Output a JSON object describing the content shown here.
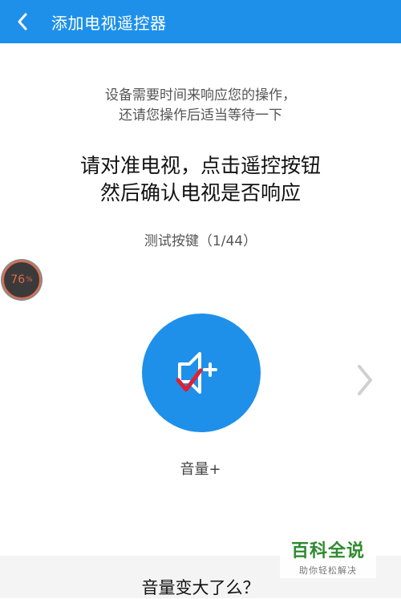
{
  "header": {
    "title": "添加电视遥控器",
    "back_icon": "chevron-left-icon"
  },
  "main": {
    "subtitle_line1": "设备需要时间来响应您的操作，",
    "subtitle_line2": "还请您操作后适当等待一下",
    "instruction_line1": "请对准电视，点击遥控按钮",
    "instruction_line2": "然后确认电视是否响应",
    "test_counter": "测试按键（1/44）",
    "key_icon": "volume-up-icon",
    "key_label": "音量+",
    "next_icon": "chevron-right-icon",
    "question": "音量变大了么？"
  },
  "floating_badge": {
    "value": "76",
    "unit": "%"
  },
  "watermark": {
    "main": "百科全说",
    "sub": "助你轻松解决"
  },
  "colors": {
    "primary": "#1e90ea",
    "check_mark": "#e02030",
    "badge_ring": "#e56a4a",
    "watermark_green": "#2f8a2f"
  }
}
